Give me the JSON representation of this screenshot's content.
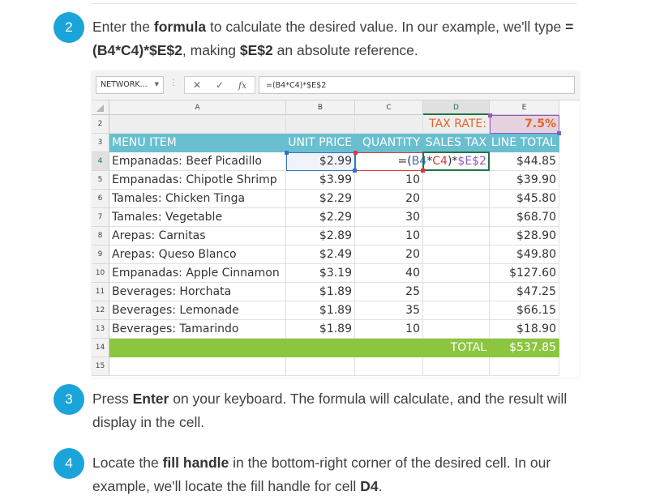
{
  "steps": [
    {
      "number": "2",
      "parts": [
        "Enter the ",
        "formula",
        " to calculate the desired value. In our example, we'll type ",
        "=(B4*C4)*$E$2",
        ", making ",
        "$E$2",
        " an absolute reference."
      ]
    },
    {
      "number": "3",
      "parts": [
        "Press ",
        "Enter",
        " on your keyboard. The formula will calculate, and the result will display in the cell."
      ]
    },
    {
      "number": "4",
      "parts": [
        "Locate the ",
        "fill handle",
        " in the bottom-right corner of the desired cell. In our example, we'll locate the fill handle for cell ",
        "D4",
        "."
      ]
    }
  ],
  "spreadsheet": {
    "name_box": "NETWORK...",
    "formula_bar": {
      "cancel_icon": "x-icon",
      "enter_icon": "check-icon",
      "function_label": "fx",
      "value": "=(B4*C4)*$E$2"
    },
    "columns": [
      "A",
      "B",
      "C",
      "D",
      "E"
    ],
    "row_numbers": [
      "2",
      "3",
      "4",
      "5",
      "6",
      "7",
      "8",
      "9",
      "10",
      "11",
      "12",
      "13",
      "14",
      "15"
    ],
    "tax_label": "TAX RATE:",
    "tax_value": "7.5%",
    "headers": [
      "MENU ITEM",
      "UNIT PRICE",
      "QUANTITY",
      "SALES TAX",
      "LINE TOTAL"
    ],
    "edit_formula_parts": [
      "=(",
      "B4",
      "*",
      "C4",
      ")*",
      "$E$2"
    ],
    "rows": [
      {
        "item": "Empanadas: Beef Picadillo",
        "price": "$2.99",
        "qty": "",
        "total": "$44.85"
      },
      {
        "item": "Empanadas: Chipotle Shrimp",
        "price": "$3.99",
        "qty": "10",
        "total": "$39.90"
      },
      {
        "item": "Tamales: Chicken Tinga",
        "price": "$2.29",
        "qty": "20",
        "total": "$45.80"
      },
      {
        "item": "Tamales: Vegetable",
        "price": "$2.29",
        "qty": "30",
        "total": "$68.70"
      },
      {
        "item": "Arepas: Carnitas",
        "price": "$2.89",
        "qty": "10",
        "total": "$28.90"
      },
      {
        "item": "Arepas: Queso Blanco",
        "price": "$2.49",
        "qty": "20",
        "total": "$49.80"
      },
      {
        "item": "Empanadas: Apple Cinnamon",
        "price": "$3.19",
        "qty": "40",
        "total": "$127.60"
      },
      {
        "item": "Beverages: Horchata",
        "price": "$1.89",
        "qty": "25",
        "total": "$47.25"
      },
      {
        "item": "Beverages: Lemonade",
        "price": "$1.89",
        "qty": "35",
        "total": "$66.15"
      },
      {
        "item": "Beverages: Tamarindo",
        "price": "$1.89",
        "qty": "10",
        "total": "$18.90"
      }
    ],
    "total_label": "TOTAL",
    "total_value": "$537.85",
    "colors": {
      "header_fill": "#69bfcf",
      "total_fill": "#8cc63f",
      "tax_fill": "#e6d3e0",
      "tax_text": "#e9622a",
      "step_badge": "#1ba4d9"
    }
  }
}
